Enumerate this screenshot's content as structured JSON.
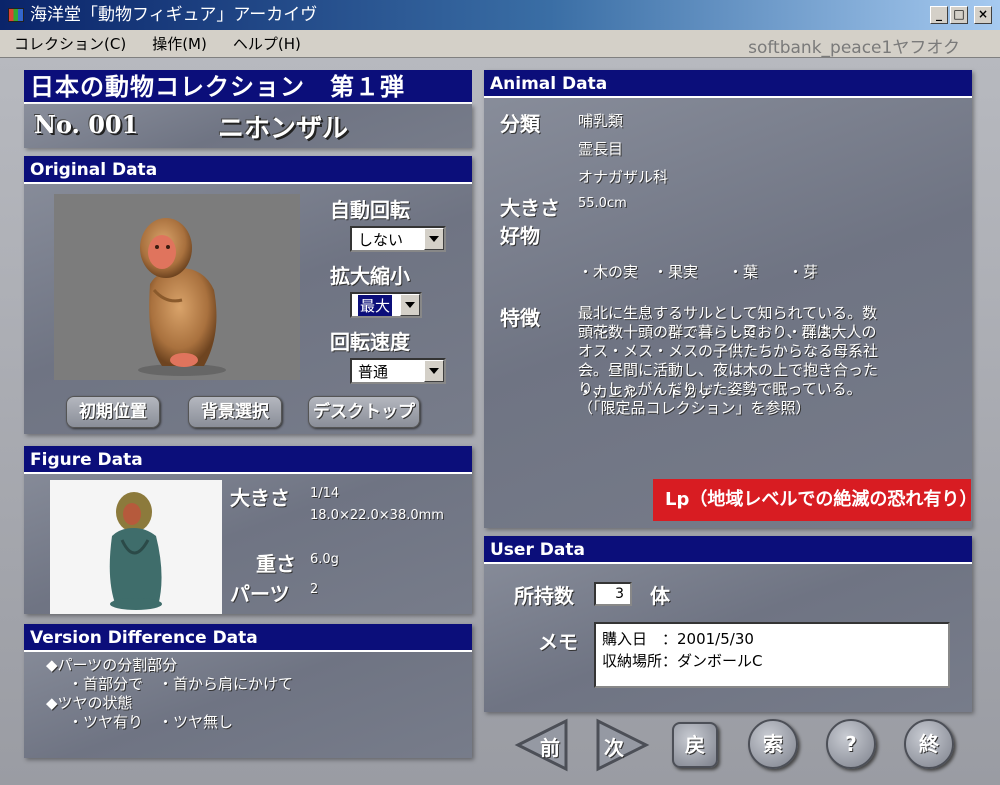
{
  "window": {
    "title": "海洋堂「動物フィギュア」アーカイヴ",
    "watermark": "softbank_peace1ヤフオク",
    "min": "_",
    "max": "□",
    "close": "×"
  },
  "menu": [
    "コレクション(C)",
    "操作(M)",
    "ヘルプ(H)"
  ],
  "collection": {
    "title": "日本の動物コレクション　第１弾",
    "number": "No. 001",
    "name": "ニホンザル"
  },
  "original": {
    "header": "Original Data",
    "auto_rotate_label": "自動回転",
    "auto_rotate_value": "しない",
    "zoom_label": "拡大縮小",
    "zoom_value": "最大",
    "speed_label": "回転速度",
    "speed_value": "普通",
    "btn_reset": "初期位置",
    "btn_bg": "背景選択",
    "btn_desktop": "デスクトップ"
  },
  "figure": {
    "header": "Figure Data",
    "size_label": "大きさ",
    "size_scale": "1/14",
    "size_dims": "18.0×22.0×38.0mm",
    "weight_label": "重さ",
    "weight_value": "6.0g",
    "parts_label": "パーツ",
    "parts_value": "2"
  },
  "version": {
    "header": "Version Difference Data",
    "line1": "◆パーツの分割部分",
    "line2": "・首部分で　・首から肩にかけて",
    "line3": "◆ツヤの状態",
    "line4": "・ツヤ有り　・ツヤ無し"
  },
  "animal": {
    "header": "Animal Data",
    "class_label": "分類",
    "class1": "哺乳類",
    "class2": "霊長目",
    "class3": "オナガザル科",
    "size_label": "大きさ",
    "size_value": "55.0cm",
    "food_label": "好物",
    "food_row1": "・木の実　・果実　　・葉　　・芽",
    "food_row2": "・花　　　・キノコ　・貝　　・昆虫",
    "food_row3": "・カエル　・トカゲ",
    "feature_label": "特徴",
    "feature_l1": "最北に生息するサルとして知られている。数",
    "feature_l2": "頭～数十頭の群で暮らしており、群は大人の",
    "feature_l3": "オス・メス・メスの子供たちからなる母系社",
    "feature_l4": "会。昼間に活動し、夜は木の上で抱き合った",
    "feature_l5": "り、しゃがんだりした姿勢で眠っている。",
    "feature_l6": "（「限定品コレクション」を参照）",
    "status": "Lp（地域レベルでの絶滅の恐れ有り）"
  },
  "user": {
    "header": "User Data",
    "count_label": "所持数",
    "count_value": "3",
    "count_unit": "体",
    "memo_label": "メモ",
    "memo_line1": "購入日　：2001/5/30",
    "memo_line2": "収納場所：ダンボールC"
  },
  "nav": {
    "prev": "前",
    "next": "次",
    "back": "戻",
    "search": "索",
    "help": "?",
    "exit": "終"
  },
  "colors": {
    "header_bg": "#0b0e7a",
    "status_red": "#d81c22"
  }
}
